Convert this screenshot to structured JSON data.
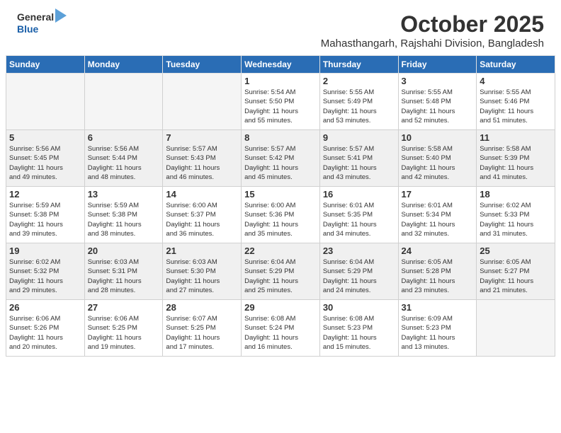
{
  "header": {
    "logo_line1": "General",
    "logo_line2": "Blue",
    "month": "October 2025",
    "location": "Mahasthangarh, Rajshahi Division, Bangladesh"
  },
  "days_of_week": [
    "Sunday",
    "Monday",
    "Tuesday",
    "Wednesday",
    "Thursday",
    "Friday",
    "Saturday"
  ],
  "weeks": [
    {
      "shaded": false,
      "days": [
        {
          "num": "",
          "info": ""
        },
        {
          "num": "",
          "info": ""
        },
        {
          "num": "",
          "info": ""
        },
        {
          "num": "1",
          "info": "Sunrise: 5:54 AM\nSunset: 5:50 PM\nDaylight: 11 hours\nand 55 minutes."
        },
        {
          "num": "2",
          "info": "Sunrise: 5:55 AM\nSunset: 5:49 PM\nDaylight: 11 hours\nand 53 minutes."
        },
        {
          "num": "3",
          "info": "Sunrise: 5:55 AM\nSunset: 5:48 PM\nDaylight: 11 hours\nand 52 minutes."
        },
        {
          "num": "4",
          "info": "Sunrise: 5:55 AM\nSunset: 5:46 PM\nDaylight: 11 hours\nand 51 minutes."
        }
      ]
    },
    {
      "shaded": true,
      "days": [
        {
          "num": "5",
          "info": "Sunrise: 5:56 AM\nSunset: 5:45 PM\nDaylight: 11 hours\nand 49 minutes."
        },
        {
          "num": "6",
          "info": "Sunrise: 5:56 AM\nSunset: 5:44 PM\nDaylight: 11 hours\nand 48 minutes."
        },
        {
          "num": "7",
          "info": "Sunrise: 5:57 AM\nSunset: 5:43 PM\nDaylight: 11 hours\nand 46 minutes."
        },
        {
          "num": "8",
          "info": "Sunrise: 5:57 AM\nSunset: 5:42 PM\nDaylight: 11 hours\nand 45 minutes."
        },
        {
          "num": "9",
          "info": "Sunrise: 5:57 AM\nSunset: 5:41 PM\nDaylight: 11 hours\nand 43 minutes."
        },
        {
          "num": "10",
          "info": "Sunrise: 5:58 AM\nSunset: 5:40 PM\nDaylight: 11 hours\nand 42 minutes."
        },
        {
          "num": "11",
          "info": "Sunrise: 5:58 AM\nSunset: 5:39 PM\nDaylight: 11 hours\nand 41 minutes."
        }
      ]
    },
    {
      "shaded": false,
      "days": [
        {
          "num": "12",
          "info": "Sunrise: 5:59 AM\nSunset: 5:38 PM\nDaylight: 11 hours\nand 39 minutes."
        },
        {
          "num": "13",
          "info": "Sunrise: 5:59 AM\nSunset: 5:38 PM\nDaylight: 11 hours\nand 38 minutes."
        },
        {
          "num": "14",
          "info": "Sunrise: 6:00 AM\nSunset: 5:37 PM\nDaylight: 11 hours\nand 36 minutes."
        },
        {
          "num": "15",
          "info": "Sunrise: 6:00 AM\nSunset: 5:36 PM\nDaylight: 11 hours\nand 35 minutes."
        },
        {
          "num": "16",
          "info": "Sunrise: 6:01 AM\nSunset: 5:35 PM\nDaylight: 11 hours\nand 34 minutes."
        },
        {
          "num": "17",
          "info": "Sunrise: 6:01 AM\nSunset: 5:34 PM\nDaylight: 11 hours\nand 32 minutes."
        },
        {
          "num": "18",
          "info": "Sunrise: 6:02 AM\nSunset: 5:33 PM\nDaylight: 11 hours\nand 31 minutes."
        }
      ]
    },
    {
      "shaded": true,
      "days": [
        {
          "num": "19",
          "info": "Sunrise: 6:02 AM\nSunset: 5:32 PM\nDaylight: 11 hours\nand 29 minutes."
        },
        {
          "num": "20",
          "info": "Sunrise: 6:03 AM\nSunset: 5:31 PM\nDaylight: 11 hours\nand 28 minutes."
        },
        {
          "num": "21",
          "info": "Sunrise: 6:03 AM\nSunset: 5:30 PM\nDaylight: 11 hours\nand 27 minutes."
        },
        {
          "num": "22",
          "info": "Sunrise: 6:04 AM\nSunset: 5:29 PM\nDaylight: 11 hours\nand 25 minutes."
        },
        {
          "num": "23",
          "info": "Sunrise: 6:04 AM\nSunset: 5:29 PM\nDaylight: 11 hours\nand 24 minutes."
        },
        {
          "num": "24",
          "info": "Sunrise: 6:05 AM\nSunset: 5:28 PM\nDaylight: 11 hours\nand 23 minutes."
        },
        {
          "num": "25",
          "info": "Sunrise: 6:05 AM\nSunset: 5:27 PM\nDaylight: 11 hours\nand 21 minutes."
        }
      ]
    },
    {
      "shaded": false,
      "days": [
        {
          "num": "26",
          "info": "Sunrise: 6:06 AM\nSunset: 5:26 PM\nDaylight: 11 hours\nand 20 minutes."
        },
        {
          "num": "27",
          "info": "Sunrise: 6:06 AM\nSunset: 5:25 PM\nDaylight: 11 hours\nand 19 minutes."
        },
        {
          "num": "28",
          "info": "Sunrise: 6:07 AM\nSunset: 5:25 PM\nDaylight: 11 hours\nand 17 minutes."
        },
        {
          "num": "29",
          "info": "Sunrise: 6:08 AM\nSunset: 5:24 PM\nDaylight: 11 hours\nand 16 minutes."
        },
        {
          "num": "30",
          "info": "Sunrise: 6:08 AM\nSunset: 5:23 PM\nDaylight: 11 hours\nand 15 minutes."
        },
        {
          "num": "31",
          "info": "Sunrise: 6:09 AM\nSunset: 5:23 PM\nDaylight: 11 hours\nand 13 minutes."
        },
        {
          "num": "",
          "info": ""
        }
      ]
    }
  ]
}
